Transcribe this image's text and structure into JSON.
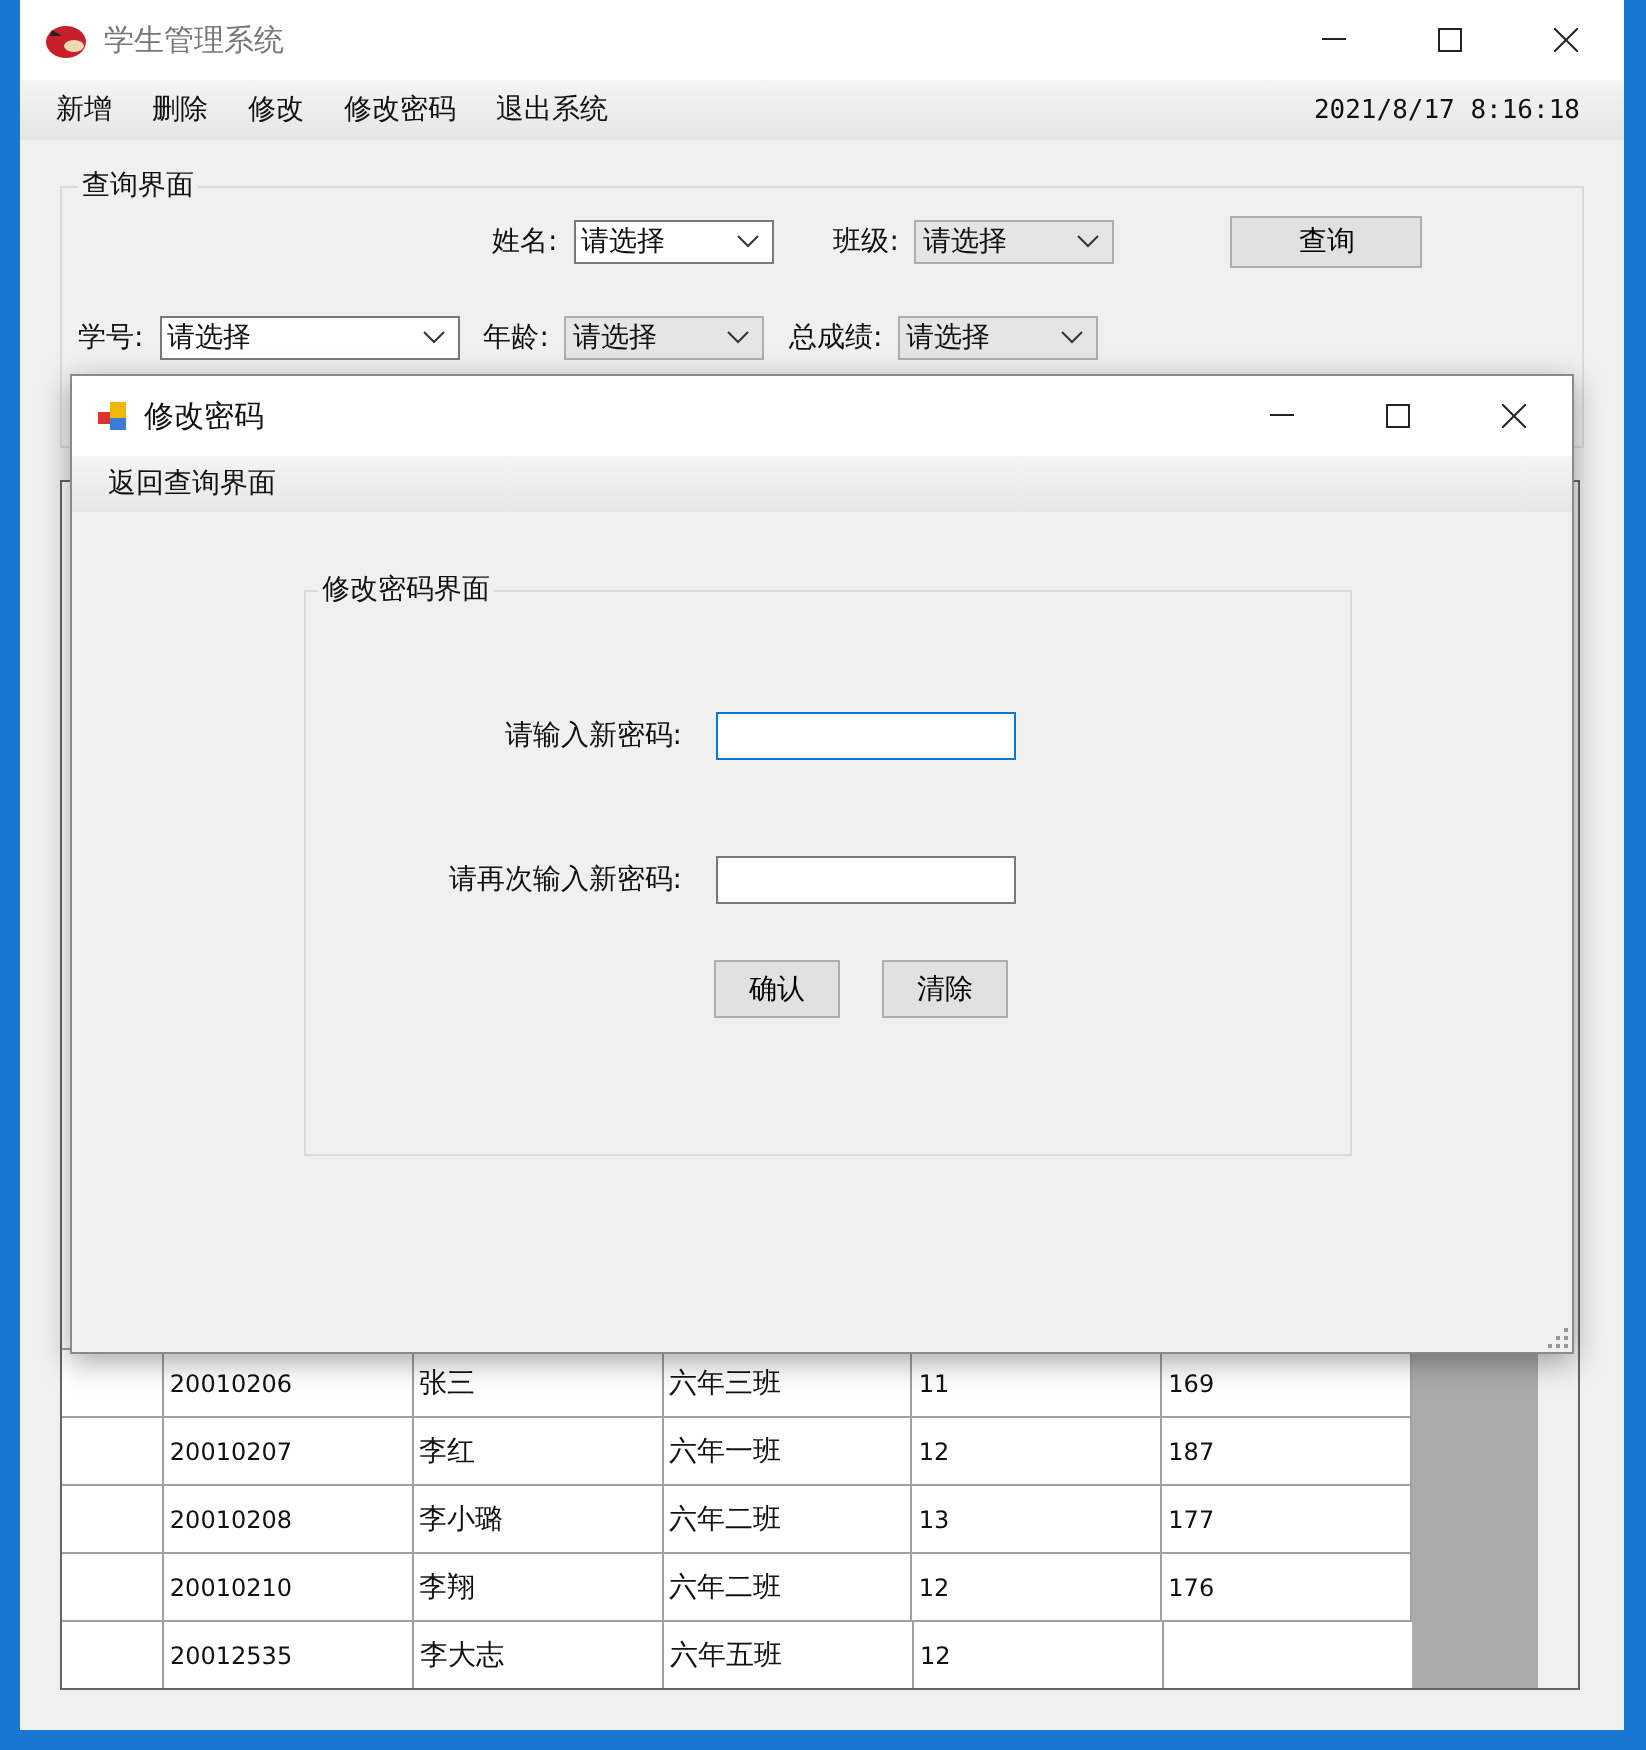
{
  "main_window": {
    "title": "学生管理系统"
  },
  "menu": [
    "新增",
    "删除",
    "修改",
    "修改密码",
    "退出系统"
  ],
  "clock": "2021/8/17 8:16:18",
  "query_group": {
    "title": "查询界面",
    "row_1": [
      {
        "label": "姓名:",
        "value": "请选择",
        "kind": "editable"
      },
      {
        "label": "班级:",
        "value": "请选择",
        "kind": "list"
      }
    ],
    "row_2": [
      {
        "label": "学号:",
        "value": "请选择",
        "kind": "editable"
      },
      {
        "label": "年龄:",
        "value": "请选择",
        "kind": "list"
      },
      {
        "label": "总成绩:",
        "value": "请选择",
        "kind": "list"
      }
    ],
    "button": "查询"
  },
  "table": {
    "rows": [
      [
        "20010206",
        "张三",
        "六年三班",
        "11",
        "169"
      ],
      [
        "20010207",
        "李红",
        "六年一班",
        "12",
        "187"
      ],
      [
        "20010208",
        "李小璐",
        "六年二班",
        "13",
        "177"
      ],
      [
        "20010210",
        "李翔",
        "六年二班",
        "12",
        "176"
      ],
      [
        "20012535",
        "李大志",
        "六年五班",
        "12"
      ]
    ]
  },
  "dialog": {
    "title": "修改密码",
    "menu": "返回查询界面",
    "group_title": "修改密码界面",
    "fields": [
      {
        "label": "请输入新密码:",
        "focused": true
      },
      {
        "label": "请再次输入新密码:",
        "focused": false
      }
    ],
    "buttons": [
      "确认",
      "清除"
    ]
  }
}
